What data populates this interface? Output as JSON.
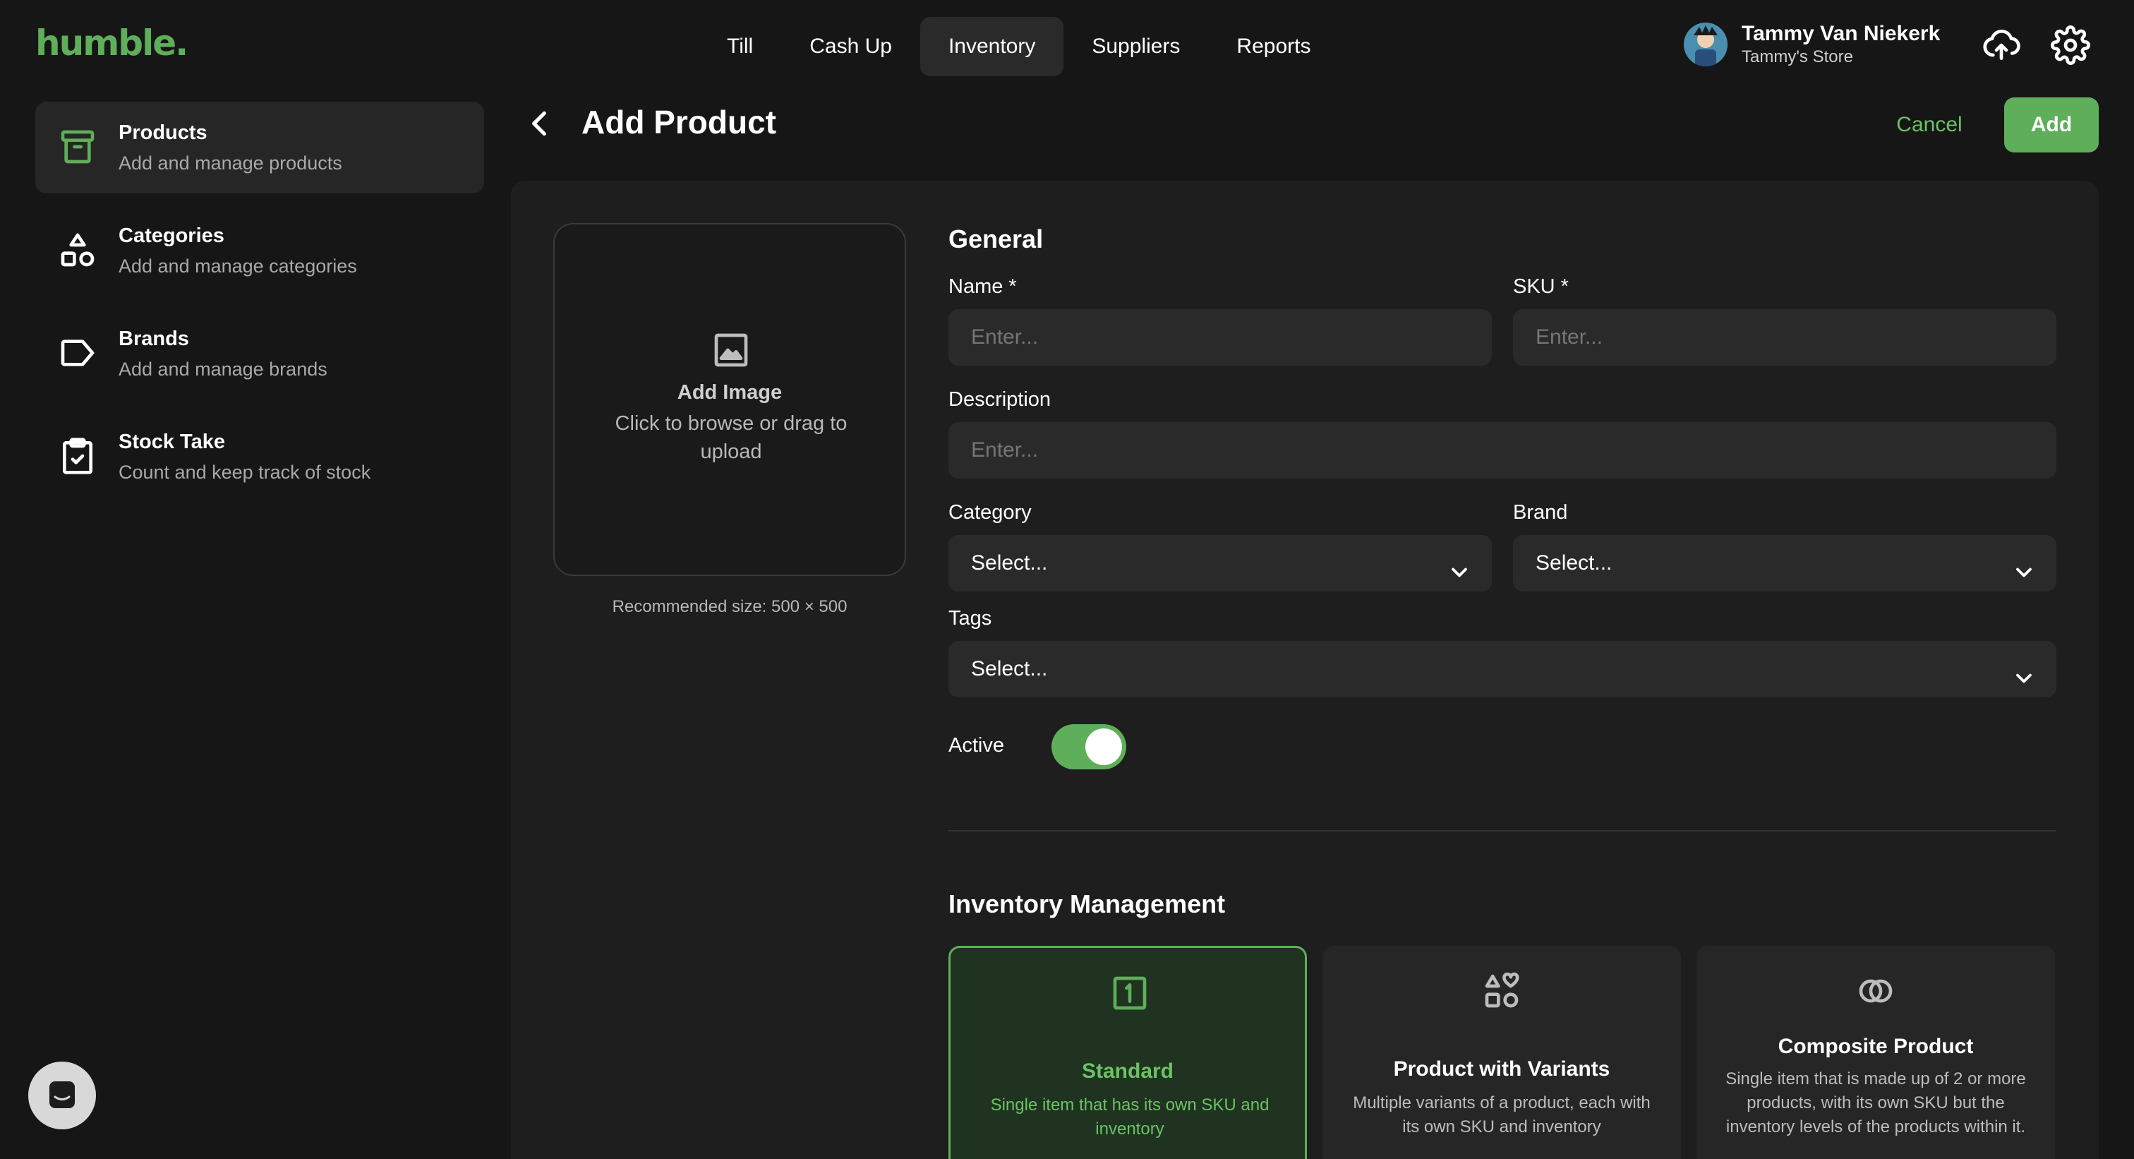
{
  "brand": {
    "logo_text": "humble.",
    "accent": "#5fae5a"
  },
  "nav": {
    "items": [
      {
        "label": "Till"
      },
      {
        "label": "Cash Up"
      },
      {
        "label": "Inventory"
      },
      {
        "label": "Suppliers"
      },
      {
        "label": "Reports"
      }
    ],
    "active": "Inventory"
  },
  "user": {
    "name": "Tammy Van Niekerk",
    "store": "Tammy's Store"
  },
  "icons": {
    "sync": "cloud-upload-icon",
    "settings": "gear-icon"
  },
  "sidebar": {
    "items": [
      {
        "title": "Products",
        "subtitle": "Add and manage products",
        "icon": "archive-box-icon",
        "active": true
      },
      {
        "title": "Categories",
        "subtitle": "Add and manage categories",
        "icon": "shapes-icon"
      },
      {
        "title": "Brands",
        "subtitle": "Add and manage brands",
        "icon": "tag-icon"
      },
      {
        "title": "Stock Take",
        "subtitle": "Count and keep track of stock",
        "icon": "clipboard-check-icon"
      }
    ]
  },
  "header": {
    "title": "Add Product",
    "cancel_label": "Cancel",
    "add_label": "Add"
  },
  "image_upload": {
    "title": "Add Image",
    "subtitle": "Click to browse or drag to upload",
    "recommended": "Recommended size: 500 × 500"
  },
  "general": {
    "title": "General",
    "name": {
      "label": "Name *",
      "placeholder": "Enter..."
    },
    "sku": {
      "label": "SKU *",
      "placeholder": "Enter..."
    },
    "description": {
      "label": "Description",
      "placeholder": "Enter..."
    },
    "category": {
      "label": "Category",
      "value": "Select..."
    },
    "brand": {
      "label": "Brand",
      "value": "Select..."
    },
    "tags": {
      "label": "Tags",
      "value": "Select..."
    },
    "active": {
      "label": "Active",
      "on": true
    }
  },
  "inventory": {
    "title": "Inventory Management",
    "options": [
      {
        "title": "Standard",
        "description": "Single item that has its own SKU and inventory",
        "icon": "numbered-box-icon",
        "selected": true
      },
      {
        "title": "Product with Variants",
        "description": "Multiple variants of a product, each with its own SKU and inventory",
        "icon": "variants-shapes-icon"
      },
      {
        "title": "Composite Product",
        "description": "Single item that is made up of 2 or more products, with its own SKU but the inventory levels of the products within it.",
        "icon": "overlapping-circles-icon"
      }
    ]
  }
}
